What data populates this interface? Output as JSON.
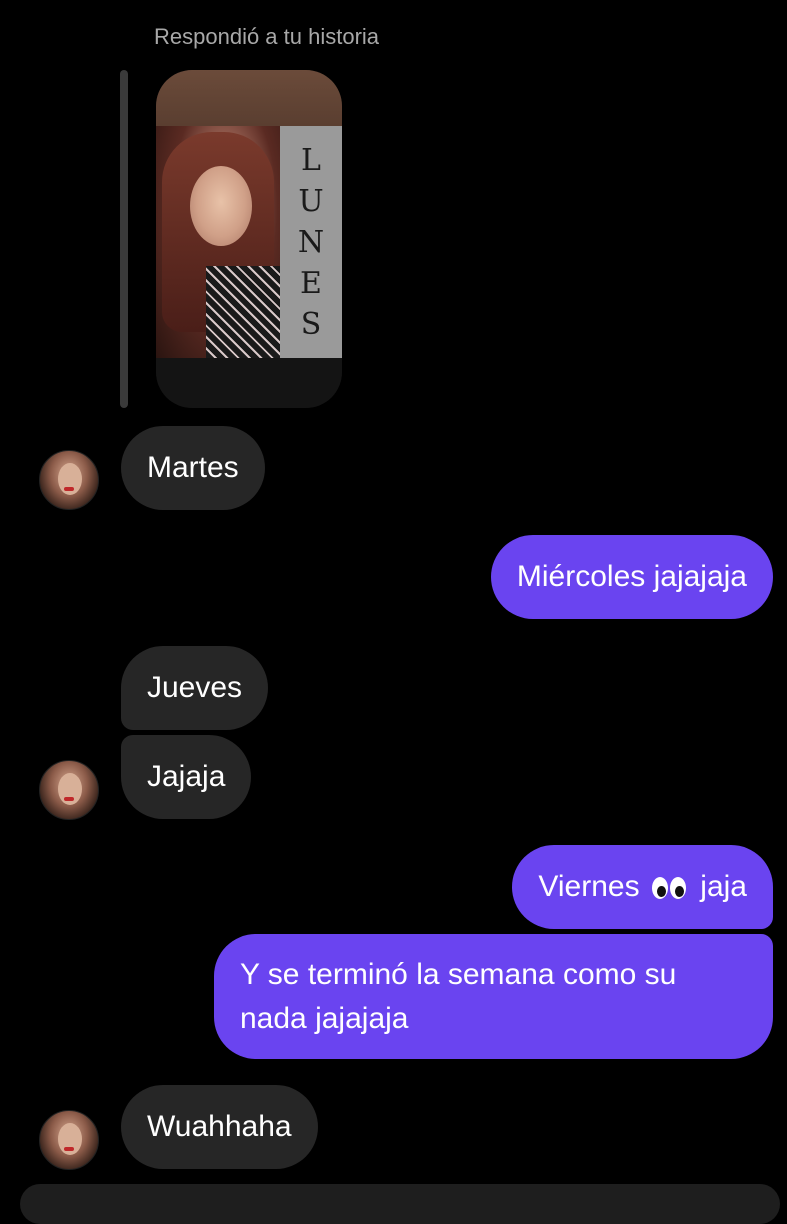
{
  "reply": {
    "caption": "Respondió a tu historia",
    "story_text": [
      "L",
      "U",
      "N",
      "E",
      "S"
    ]
  },
  "messages": [
    {
      "text": "Martes",
      "from": "them"
    },
    {
      "text": "Miércoles jajajaja",
      "from": "me"
    },
    {
      "text": "Jueves",
      "from": "them"
    },
    {
      "text": "Jajaja",
      "from": "them"
    },
    {
      "text_before": "Viernes",
      "emoji": "eyes",
      "text_after": "jaja",
      "from": "me"
    },
    {
      "text": "Y se terminó la semana como su nada jajajaja",
      "from": "me"
    },
    {
      "text": "Wuahhaha",
      "from": "them"
    }
  ],
  "colors": {
    "background": "#000000",
    "incoming_bubble": "#262626",
    "outgoing_bubble": "#6a44f0",
    "caption": "#a8a8a8"
  }
}
